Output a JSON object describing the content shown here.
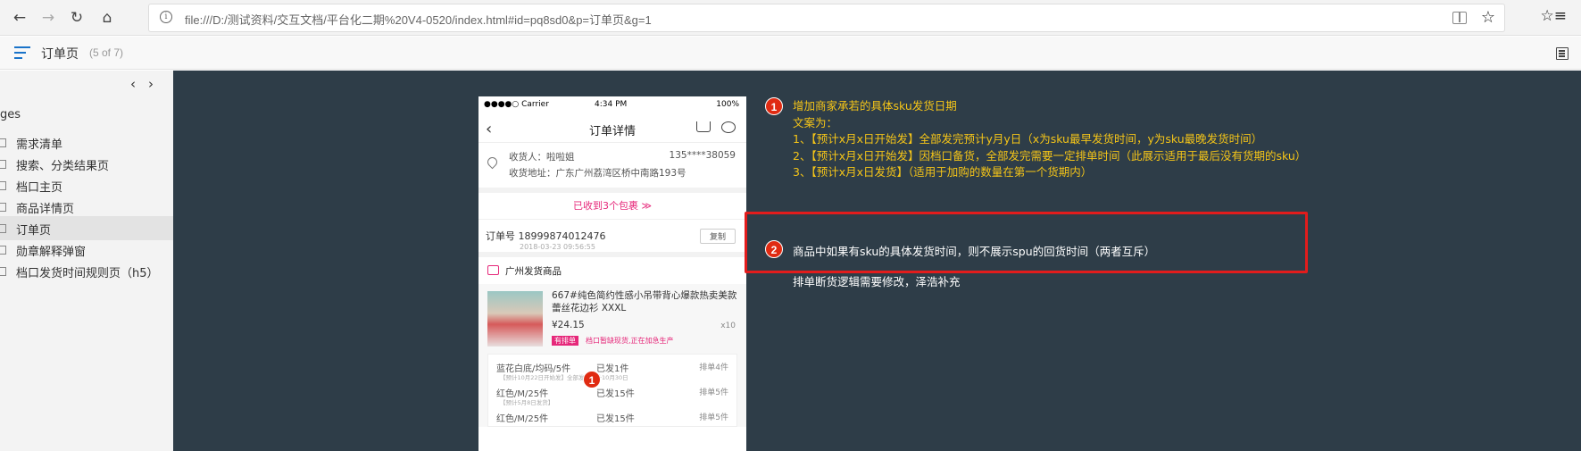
{
  "browser": {
    "url": "file:///D:/测试资料/交互文档/平台化二期%20V4-0520/index.html#id=pq8sd0&p=订单页&g=1"
  },
  "toolbar": {
    "page_title": "订单页",
    "page_count": "(5 of 7)"
  },
  "sidebar": {
    "heading": "ges",
    "items": [
      {
        "label": "需求清单"
      },
      {
        "label": "搜索、分类结果页"
      },
      {
        "label": "档口主页"
      },
      {
        "label": "商品详情页"
      },
      {
        "label": "订单页"
      },
      {
        "label": "勋章解释弹窗"
      },
      {
        "label": "档口发货时间规则页（h5）"
      }
    ]
  },
  "phone": {
    "carrier": "●●●●○ Carrier ",
    "time": "4:34 PM",
    "battery": "100%",
    "title": "订单详情",
    "receiver": "收货人：啦啦姐",
    "phone_no": "135****38059",
    "address": "收货地址：广东广州荔湾区桥中南路193号",
    "packages": "已收到3个包裹 ",
    "order_no": "订单号 18999874012476",
    "order_date": "2018-03-23 09:56:55",
    "copy": "复制",
    "store": "广州发货商品",
    "product_name": "667#纯色简约性感小吊带背心爆款热卖美款蕾丝花边衫 XXXL",
    "price": "¥24.15",
    "qty": "x10",
    "tag": "有排单",
    "tag_note": "档口暂缺现货,正在加急生产",
    "skus": [
      {
        "a": "蓝花白底/均码/5件",
        "b": "已发1件",
        "c": "排单4件",
        "note": "【预计10月22日开始发】全部发完预计10月30日"
      },
      {
        "a": "红色/M/25件",
        "b": "已发15件",
        "c": "排单5件",
        "note": "【预计5月8日发货】"
      },
      {
        "a": "红色/M/25件",
        "b": "已发15件",
        "c": "排单5件",
        "note": ""
      }
    ],
    "marker": "1"
  },
  "annotations": {
    "n1": "1",
    "n2": "2",
    "lines1": [
      "增加商家承若的具体sku发货日期",
      "文案为：",
      "1、【预计x月x日开始发】全部发完预计y月y日（x为sku最早发货时间，y为sku最晚发货时间）",
      "2、【预计x月x日开始发】因档口备货，全部发完需要一定排单时间（此展示适用于最后没有货期的sku）",
      "3、【预计x月x日发货】（适用于加购的数量在第一个货期内）"
    ],
    "line2": "商品中如果有sku的具体发货时间，则不展示spu的回货时间（两者互斥）",
    "line3": "排单断货逻辑需要修改，泽浩补充"
  }
}
